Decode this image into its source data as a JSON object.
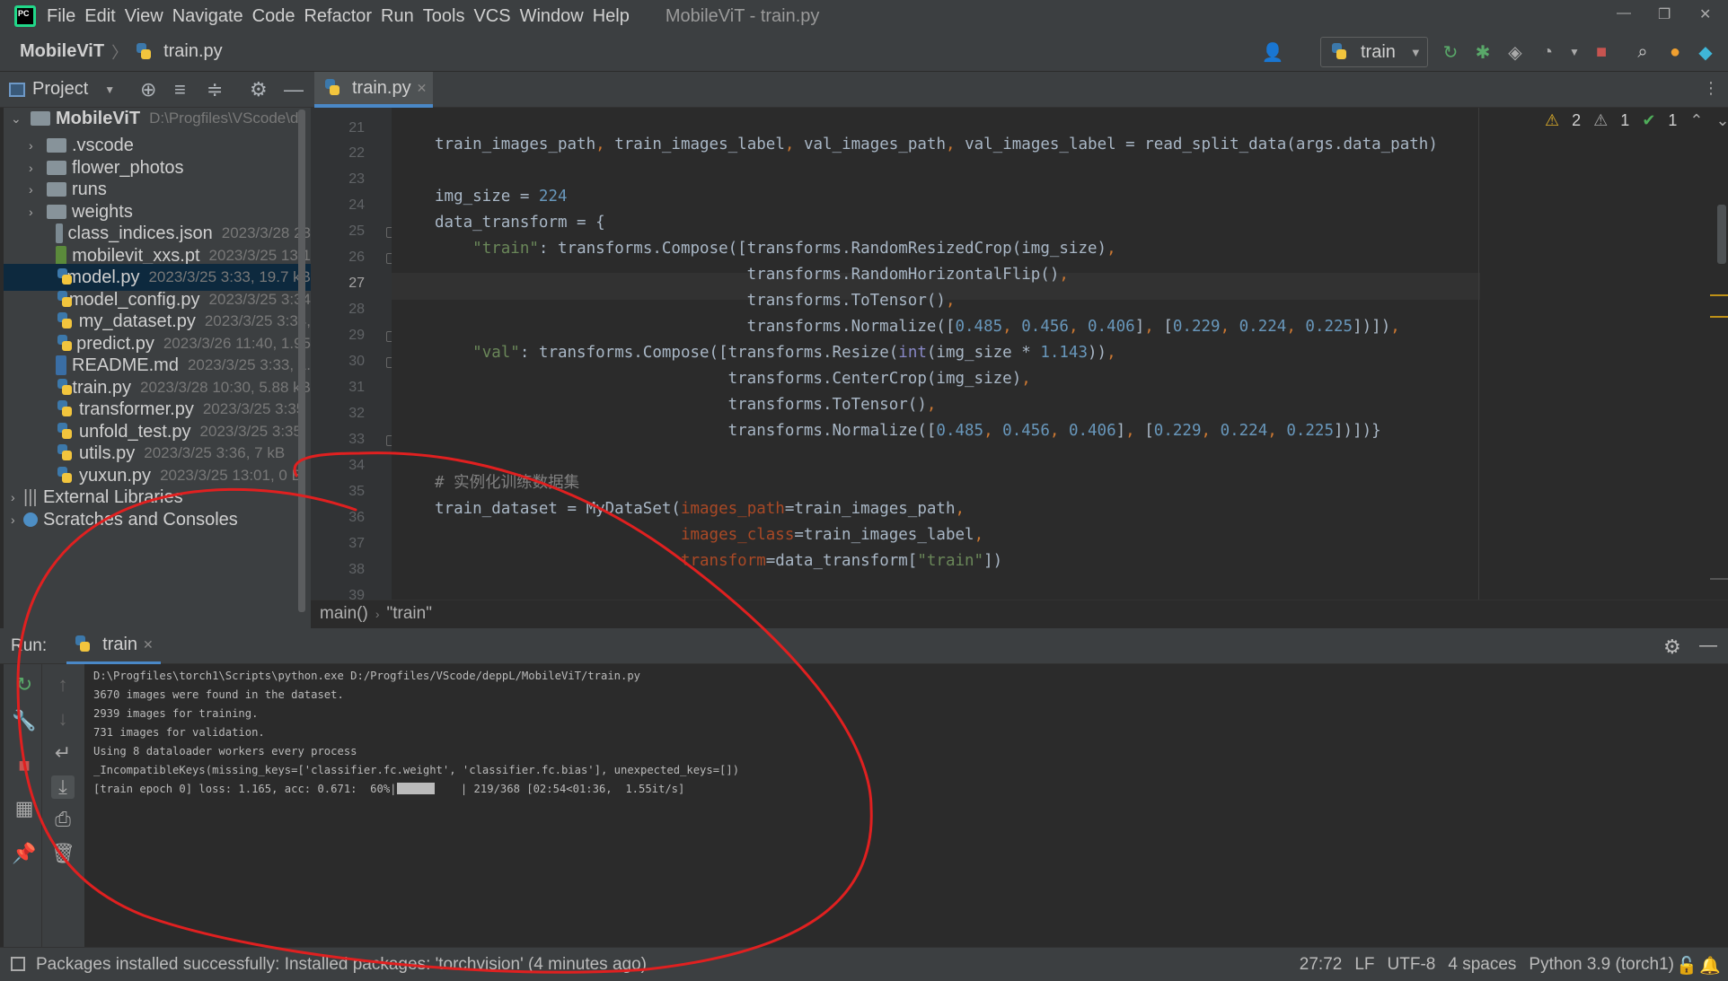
{
  "menu": [
    "File",
    "Edit",
    "View",
    "Navigate",
    "Code",
    "Refactor",
    "Run",
    "Tools",
    "VCS",
    "Window",
    "Help"
  ],
  "window_title": "MobileViT - train.py",
  "breadcrumb_top": {
    "project": "MobileViT",
    "file": "train.py"
  },
  "run_config": "train",
  "project_panel": {
    "label": "Project",
    "root": {
      "name": "MobileViT",
      "path": "D:\\Progfiles\\VScode\\d"
    },
    "items": [
      {
        "type": "folder",
        "name": ".vscode",
        "meta": ""
      },
      {
        "type": "folder",
        "name": "flower_photos",
        "meta": ""
      },
      {
        "type": "folder",
        "name": "runs",
        "meta": ""
      },
      {
        "type": "folder",
        "name": "weights",
        "meta": ""
      },
      {
        "type": "json",
        "name": "class_indices.json",
        "meta": "2023/3/28 23"
      },
      {
        "type": "pt",
        "name": "mobilevit_xxs.pt",
        "meta": "2023/3/25 13:1"
      },
      {
        "type": "py",
        "name": "model.py",
        "meta": "2023/3/25 3:33, 19.7 kB"
      },
      {
        "type": "py",
        "name": "model_config.py",
        "meta": "2023/3/25 3:34"
      },
      {
        "type": "py",
        "name": "my_dataset.py",
        "meta": "2023/3/25 3:34,"
      },
      {
        "type": "py",
        "name": "predict.py",
        "meta": "2023/3/26 11:40, 1.95"
      },
      {
        "type": "md",
        "name": "README.md",
        "meta": "2023/3/25 3:33, 1."
      },
      {
        "type": "py",
        "name": "train.py",
        "meta": "2023/3/28 10:30, 5.88 kB"
      },
      {
        "type": "py",
        "name": "transformer.py",
        "meta": "2023/3/25 3:35"
      },
      {
        "type": "py",
        "name": "unfold_test.py",
        "meta": "2023/3/25 3:35"
      },
      {
        "type": "py",
        "name": "utils.py",
        "meta": "2023/3/25 3:36, 7 kB"
      },
      {
        "type": "py",
        "name": "yuxun.py",
        "meta": "2023/3/25 13:01, 0 B"
      }
    ],
    "external": "External Libraries",
    "scratches": "Scratches and Consoles"
  },
  "editor_tab": "train.py",
  "inspections": {
    "warnings": "2",
    "weak": "1",
    "ok": "1"
  },
  "line_numbers": [
    "21",
    "22",
    "23",
    "24",
    "25",
    "26",
    "27",
    "28",
    "29",
    "30",
    "31",
    "32",
    "33",
    "34",
    "35",
    "36",
    "37",
    "38",
    "39"
  ],
  "code_breadcrumb": [
    "main()",
    "\"train\""
  ],
  "run_panel": {
    "label": "Run:",
    "tab": "train"
  },
  "console": [
    "D:\\Progfiles\\torch1\\Scripts\\python.exe D:/Progfiles/VScode/deppL/MobileViT/train.py",
    "3670 images were found in the dataset.",
    "2939 images for training.",
    "731 images for validation.",
    "Using 8 dataloader workers every process",
    "_IncompatibleKeys(missing_keys=['classifier.fc.weight', 'classifier.fc.bias'], unexpected_keys=[])"
  ],
  "progress": {
    "prefix": "[train epoch 0] loss: 1.165, acc: 0.671:  60%|",
    "suffix": "    | 219/368 [02:54<01:36,  1.55it/s]",
    "fraction": 0.6
  },
  "status": {
    "message": "Packages installed successfully: Installed packages: 'torchvision' (4 minutes ago)",
    "position": "27:72",
    "line_sep": "LF",
    "encoding": "UTF-8",
    "indent": "4 spaces",
    "interpreter": "Python 3.9 (torch1)"
  },
  "colors": {
    "annotation": "#e02020",
    "accent": "#4a88c7"
  }
}
